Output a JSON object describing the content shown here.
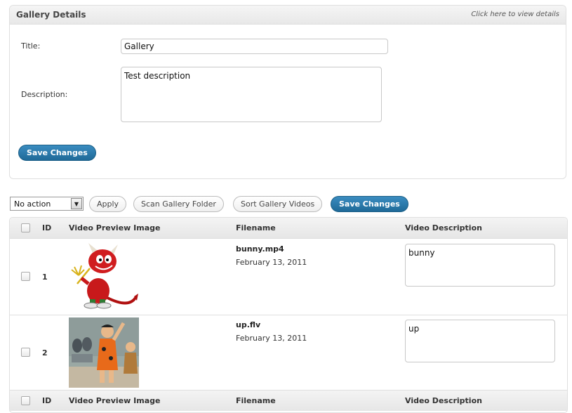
{
  "gallery_details": {
    "title": "Gallery Details",
    "hint": "Click here to view details",
    "title_label": "Title:",
    "title_value": "Gallery",
    "description_label": "Description:",
    "description_value": "Test description",
    "save_label": "Save Changes"
  },
  "toolbar": {
    "action_select_value": "No action",
    "apply_label": "Apply",
    "scan_label": "Scan Gallery Folder",
    "sort_label": "Sort Gallery Videos",
    "save_label": "Save Changes"
  },
  "table": {
    "columns": [
      "ID",
      "Video Preview Image",
      "Filename",
      "Video Description"
    ],
    "rows": [
      {
        "id": "1",
        "filename": "bunny.mp4",
        "date": "February 13, 2011",
        "description": "bunny",
        "thumbnail_icon": "devil-mascot-thumbnail"
      },
      {
        "id": "2",
        "filename": "up.flv",
        "date": "February 13, 2011",
        "description": "up",
        "thumbnail_icon": "cartoon-scene-thumbnail"
      }
    ]
  },
  "colors": {
    "primary_button": "#21759b",
    "header_gradient": "#e8e8e8",
    "border": "#dfdfdf"
  }
}
